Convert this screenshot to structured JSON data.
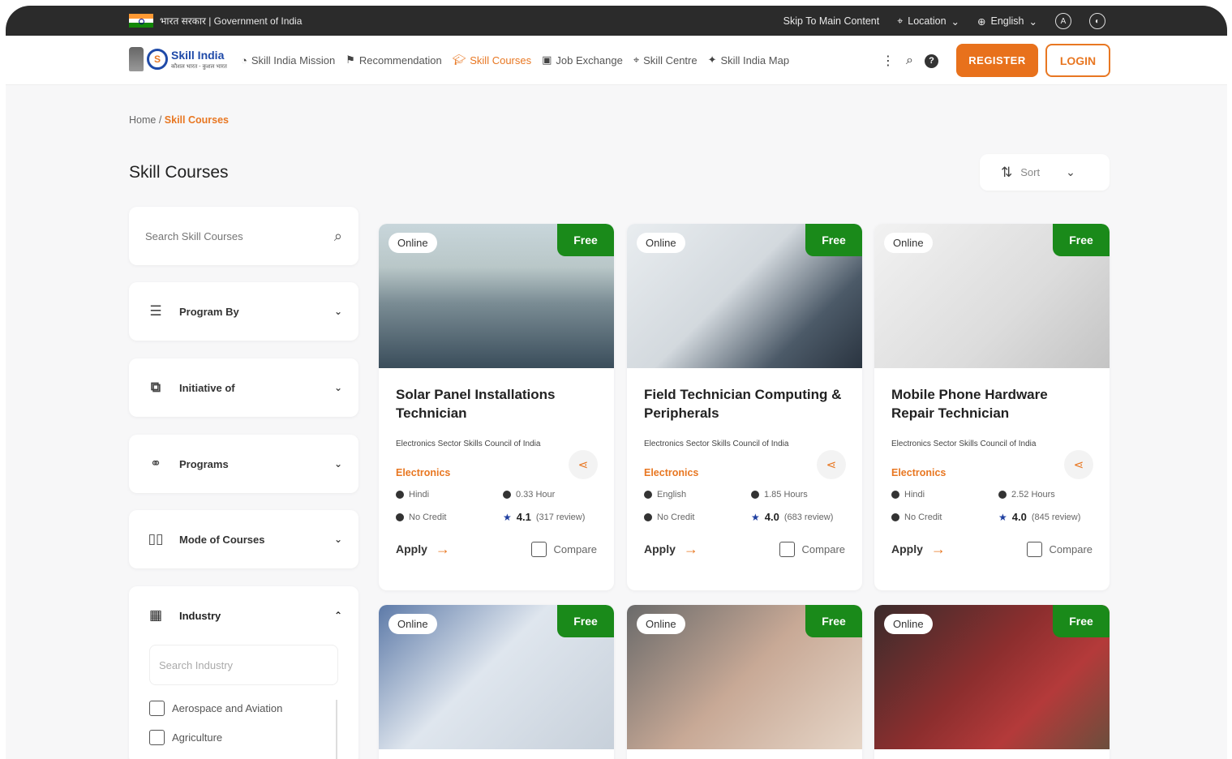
{
  "gov_bar": {
    "title": "भारत सरकार | Government of India",
    "skip": "Skip To Main Content",
    "location": "Location",
    "language": "English"
  },
  "nav": {
    "logo_title": "Skill India",
    "logo_sub": "कौशल भारत - कुशल भारत",
    "links": [
      "Skill India Mission",
      "Recommendation",
      "Skill Courses",
      "Job Exchange",
      "Skill Centre",
      "Skill India Map"
    ],
    "active": "Skill Courses",
    "register": "REGISTER",
    "login": "LOGIN"
  },
  "breadcrumb": {
    "home": "Home",
    "sep": "/",
    "current": "Skill Courses"
  },
  "page_title": "Skill Courses",
  "sort_label": "Sort",
  "sidebar": {
    "search_placeholder": "Search Skill Courses",
    "filters": [
      "Program By",
      "Initiative of",
      "Programs",
      "Mode of Courses"
    ],
    "industry": {
      "label": "Industry",
      "search_placeholder": "Search Industry",
      "options": [
        "Aerospace and Aviation",
        "Agriculture"
      ]
    }
  },
  "cards": [
    {
      "mode": "Online",
      "badge": "Free",
      "title": "Solar Panel Installations Technician",
      "org": "Electronics Sector Skills Council of India",
      "category": "Electronics",
      "language": "Hindi",
      "duration": "0.33 Hour",
      "credit": "No Credit",
      "rating": "4.1",
      "reviews": "(317 review)",
      "apply": "Apply",
      "compare": "Compare"
    },
    {
      "mode": "Online",
      "badge": "Free",
      "title": "Field Technician Computing & Peripherals",
      "org": "Electronics Sector Skills Council of India",
      "category": "Electronics",
      "language": "English",
      "duration": "1.85 Hours",
      "credit": "No Credit",
      "rating": "4.0",
      "reviews": "(683 review)",
      "apply": "Apply",
      "compare": "Compare"
    },
    {
      "mode": "Online",
      "badge": "Free",
      "title": "Mobile Phone Hardware Repair Technician",
      "org": "Electronics Sector Skills Council of India",
      "category": "Electronics",
      "language": "Hindi",
      "duration": "2.52 Hours",
      "credit": "No Credit",
      "rating": "4.0",
      "reviews": "(845 review)",
      "apply": "Apply",
      "compare": "Compare"
    },
    {
      "mode": "Online",
      "badge": "Free"
    },
    {
      "mode": "Online",
      "badge": "Free"
    },
    {
      "mode": "Online",
      "badge": "Free"
    }
  ]
}
